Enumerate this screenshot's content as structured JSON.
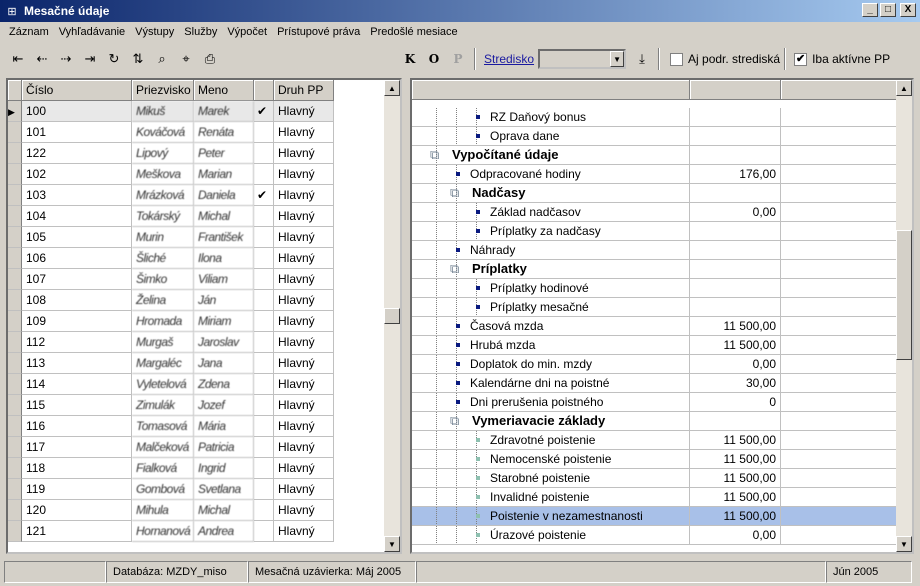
{
  "window": {
    "title": "Mesačné údaje",
    "btn_min": "_",
    "btn_max": "□",
    "btn_close": "X"
  },
  "menu": [
    "Záznam",
    "Vyhľadávanie",
    "Výstupy",
    "Služby",
    "Výpočet",
    "Prístupové práva",
    "Predošlé mesiace"
  ],
  "toolbar": {
    "k": "K",
    "o": "O",
    "p": "P",
    "stredisko_label": "Stredisko",
    "stredisko_value": "",
    "chk_podr_label": "Aj podr. strediská",
    "chk_podr_checked": "",
    "chk_aktivne_label": "Iba aktívne PP",
    "chk_aktivne_checked": "✔"
  },
  "employees": {
    "columns": [
      "Číslo",
      "Priezvisko",
      "Meno",
      "",
      "Druh PP"
    ],
    "rows": [
      {
        "cislo": "100",
        "priezvisko": "Mikuš",
        "meno": "Marek",
        "chk": "✔",
        "druh": "Hlavný"
      },
      {
        "cislo": "101",
        "priezvisko": "Kováčová",
        "meno": "Renáta",
        "chk": "",
        "druh": "Hlavný"
      },
      {
        "cislo": "122",
        "priezvisko": "Lipový",
        "meno": "Peter",
        "chk": "",
        "druh": "Hlavný"
      },
      {
        "cislo": "102",
        "priezvisko": "Meškova",
        "meno": "Marian",
        "chk": "",
        "druh": "Hlavný"
      },
      {
        "cislo": "103",
        "priezvisko": "Mrázková",
        "meno": "Daniela",
        "chk": "✔",
        "druh": "Hlavný"
      },
      {
        "cislo": "104",
        "priezvisko": "Tokárský",
        "meno": "Michal",
        "chk": "",
        "druh": "Hlavný"
      },
      {
        "cislo": "105",
        "priezvisko": "Murin",
        "meno": "František",
        "chk": "",
        "druh": "Hlavný"
      },
      {
        "cislo": "106",
        "priezvisko": "Šliché",
        "meno": "Ilona",
        "chk": "",
        "druh": "Hlavný"
      },
      {
        "cislo": "107",
        "priezvisko": "Šimko",
        "meno": "Viliam",
        "chk": "",
        "druh": "Hlavný"
      },
      {
        "cislo": "108",
        "priezvisko": "Želina",
        "meno": "Ján",
        "chk": "",
        "druh": "Hlavný"
      },
      {
        "cislo": "109",
        "priezvisko": "Hromada",
        "meno": "Miriam",
        "chk": "",
        "druh": "Hlavný"
      },
      {
        "cislo": "112",
        "priezvisko": "Murgaš",
        "meno": "Jaroslav",
        "chk": "",
        "druh": "Hlavný"
      },
      {
        "cislo": "113",
        "priezvisko": "Margaléc",
        "meno": "Jana",
        "chk": "",
        "druh": "Hlavný"
      },
      {
        "cislo": "114",
        "priezvisko": "Vyletelová",
        "meno": "Zdena",
        "chk": "",
        "druh": "Hlavný"
      },
      {
        "cislo": "115",
        "priezvisko": "Zimulák",
        "meno": "Jozef",
        "chk": "",
        "druh": "Hlavný"
      },
      {
        "cislo": "116",
        "priezvisko": "Tomasová",
        "meno": "Mária",
        "chk": "",
        "druh": "Hlavný"
      },
      {
        "cislo": "117",
        "priezvisko": "Malčeková",
        "meno": "Patricia",
        "chk": "",
        "druh": "Hlavný"
      },
      {
        "cislo": "118",
        "priezvisko": "Fialková",
        "meno": "Ingrid",
        "chk": "",
        "druh": "Hlavný"
      },
      {
        "cislo": "119",
        "priezvisko": "Gombová",
        "meno": "Svetlana",
        "chk": "",
        "druh": "Hlavný"
      },
      {
        "cislo": "120",
        "priezvisko": "Mihula",
        "meno": "Michal",
        "chk": "",
        "druh": "Hlavný"
      },
      {
        "cislo": "121",
        "priezvisko": "Hornanová",
        "meno": "Andrea",
        "chk": "",
        "druh": "Hlavný"
      }
    ]
  },
  "tree": {
    "rows": [
      {
        "label": "RZ Daňový bonus",
        "value": "",
        "level": 3,
        "kind": "leaf"
      },
      {
        "label": "Oprava dane",
        "value": "",
        "level": 3,
        "kind": "leaf"
      },
      {
        "label": "Vypočítané údaje",
        "value": "",
        "level": 1,
        "kind": "group"
      },
      {
        "label": "Odpracované hodiny",
        "value": "176,00",
        "level": 2,
        "kind": "leaf"
      },
      {
        "label": "Nadčasy",
        "value": "",
        "level": 2,
        "kind": "group"
      },
      {
        "label": "Základ nadčasov",
        "value": "0,00",
        "level": 3,
        "kind": "leaf"
      },
      {
        "label": "Príplatky za nadčasy",
        "value": "",
        "level": 3,
        "kind": "leaf"
      },
      {
        "label": "Náhrady",
        "value": "",
        "level": 2,
        "kind": "leaf"
      },
      {
        "label": "Príplatky",
        "value": "",
        "level": 2,
        "kind": "group"
      },
      {
        "label": "Príplatky hodinové",
        "value": "",
        "level": 3,
        "kind": "leaf"
      },
      {
        "label": "Príplatky mesačné",
        "value": "",
        "level": 3,
        "kind": "leaf"
      },
      {
        "label": "Časová mzda",
        "value": "11 500,00",
        "level": 2,
        "kind": "leaf"
      },
      {
        "label": "Hrubá mzda",
        "value": "11 500,00",
        "level": 2,
        "kind": "leaf"
      },
      {
        "label": "Doplatok do min. mzdy",
        "value": "0,00",
        "level": 2,
        "kind": "leaf"
      },
      {
        "label": "Kalendárne dni na poistné",
        "value": "30,00",
        "level": 2,
        "kind": "leaf"
      },
      {
        "label": "Dni prerušenia poistného",
        "value": "0",
        "level": 2,
        "kind": "leaf"
      },
      {
        "label": "Vymeriavacie základy",
        "value": "",
        "level": 2,
        "kind": "group"
      },
      {
        "label": "Zdravotné poistenie",
        "value": "11 500,00",
        "level": 3,
        "kind": "light"
      },
      {
        "label": "Nemocenské poistenie",
        "value": "11 500,00",
        "level": 3,
        "kind": "light"
      },
      {
        "label": "Starobné poistenie",
        "value": "11 500,00",
        "level": 3,
        "kind": "light"
      },
      {
        "label": "Invalidné poistenie",
        "value": "11 500,00",
        "level": 3,
        "kind": "light"
      },
      {
        "label": "Poistenie v nezamestnanosti",
        "value": "11 500,00",
        "level": 3,
        "kind": "light",
        "selected": true
      },
      {
        "label": "Úrazové poistenie",
        "value": "0,00",
        "level": 3,
        "kind": "light"
      }
    ]
  },
  "status": {
    "p1": "",
    "databaza": "Databáza: MZDY_miso",
    "uzavierka": "Mesačná uzávierka: Máj 2005",
    "p4": "",
    "mesiac": "Jún 2005"
  }
}
